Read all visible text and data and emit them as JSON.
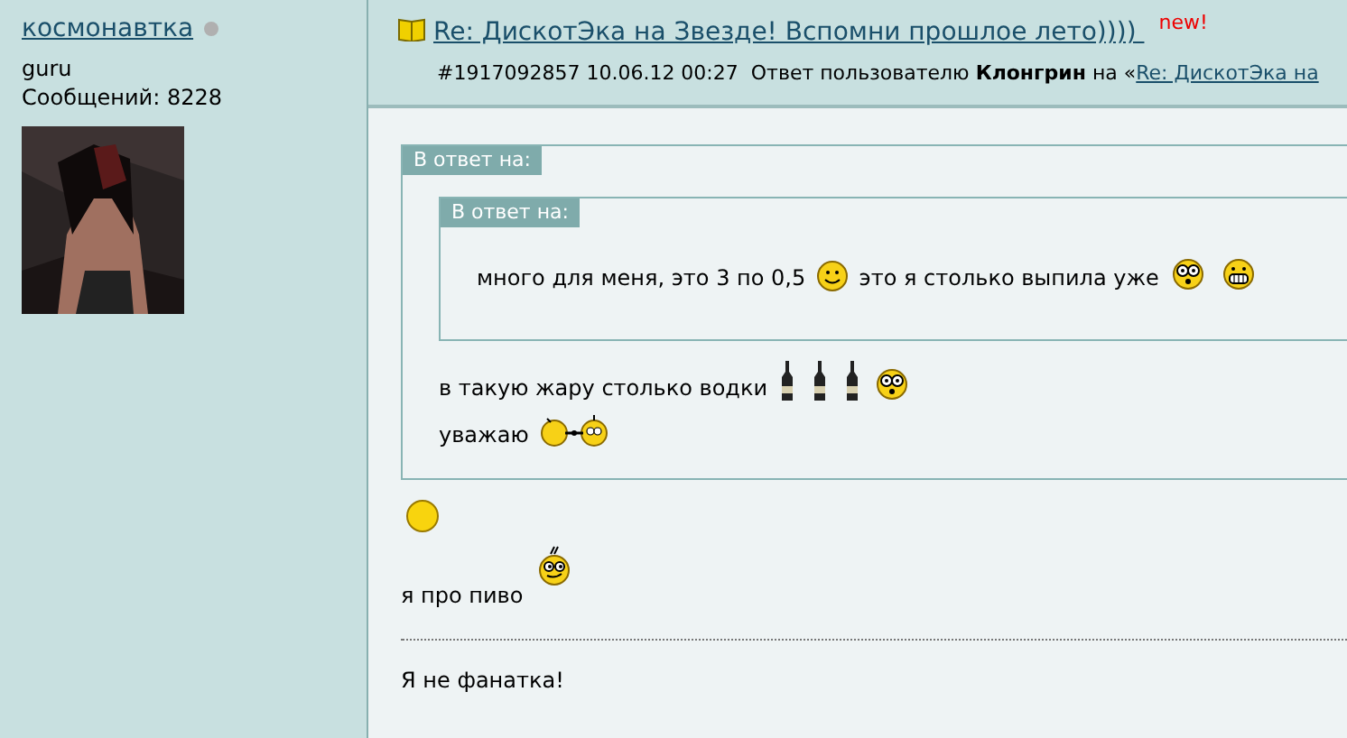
{
  "author": {
    "name": "космонавтка",
    "online": false,
    "rank": "guru",
    "posts": "Сообщений: 8228"
  },
  "post": {
    "title": "Re: ДискотЭка на Звезде! Вспомни прошлое лето)))) ",
    "new": "new!",
    "number": "#1917092857",
    "date": "10.06.12 00:27",
    "reply_prefix": "Ответ пользователю",
    "reply_user": "Клонгрин",
    "reply_on": "на «",
    "reply_link": "Re: ДискотЭка на"
  },
  "body": [
    {
      "kind": "quote",
      "label": "В ответ на:",
      "content": [
        {
          "kind": "quote",
          "label": "В ответ на:",
          "content": [
            {
              "kind": "line",
              "parts": [
                {
                  "kind": "text",
                  "text": "много для меня, это 3 по 0,5"
                },
                {
                  "kind": "smile"
                },
                {
                  "kind": "text",
                  "text": "это я столько выпила уже"
                },
                {
                  "kind": "shock"
                },
                {
                  "kind": "grin"
                }
              ]
            }
          ]
        },
        {
          "kind": "line",
          "parts": [
            {
              "kind": "text",
              "text": "в такую жару столько водки"
            },
            {
              "kind": "bottle"
            },
            {
              "kind": "bottle"
            },
            {
              "kind": "bottle"
            },
            {
              "kind": "shock"
            }
          ]
        },
        {
          "kind": "line",
          "parts": [
            {
              "kind": "text",
              "text": "уважаю"
            },
            {
              "kind": "clink"
            }
          ]
        }
      ]
    },
    {
      "kind": "line",
      "parts": [
        {
          "kind": "ball"
        }
      ]
    },
    {
      "kind": "line",
      "parts": [
        {
          "kind": "text",
          "text": "я про пиво"
        },
        {
          "kind": "nerd"
        }
      ]
    },
    {
      "kind": "rule"
    },
    {
      "kind": "line",
      "parts": [
        {
          "kind": "text",
          "text": "Я не фанатка!"
        }
      ]
    }
  ]
}
